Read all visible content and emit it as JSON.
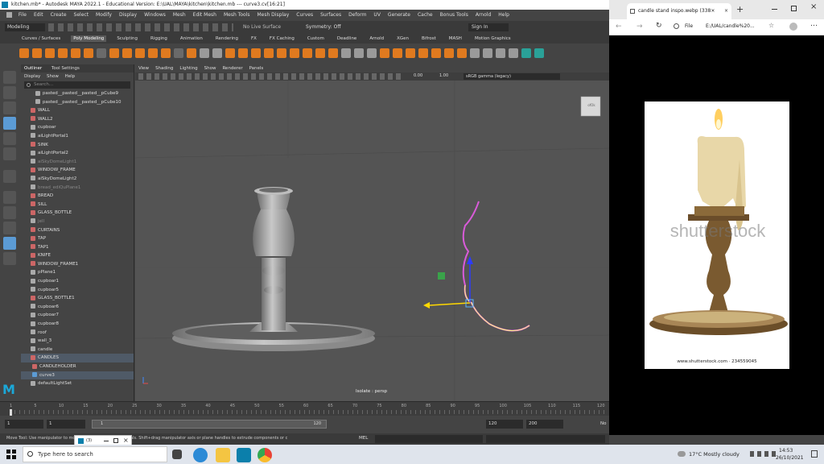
{
  "maya": {
    "title": "kitchen.mb* - Autodesk MAYA 2022.1 - Educational Version: E:\\UAL\\MAYA\\kitchen\\kitchen.mb  ---  curve3.cv[16:21]",
    "menu": [
      "File",
      "Edit",
      "Create",
      "Select",
      "Modify",
      "Display",
      "Windows",
      "Mesh",
      "Edit Mesh",
      "Mesh Tools",
      "Mesh Display",
      "Curves",
      "Surfaces",
      "Deform",
      "UV",
      "Generate",
      "Cache",
      "Bonus Tools",
      "Arnold",
      "Help"
    ],
    "status": {
      "mode": "Modeling",
      "live": "No Live Surface",
      "symmetry": "Symmetry: Off",
      "signin": "Sign In"
    },
    "shelf_tabs": [
      "Curves / Surfaces",
      "Poly Modeling",
      "Sculpting",
      "Rigging",
      "Animation",
      "Rendering",
      "FX",
      "FX Caching",
      "Custom",
      "Deadline",
      "Arnold",
      "XGen",
      "Bifrost",
      "MASH",
      "Motion Graphics"
    ],
    "outliner": {
      "tabs": [
        "Outliner",
        "Tool Settings"
      ],
      "menu": [
        "Display",
        "Show",
        "Help"
      ],
      "search": "Search...",
      "items": [
        "pasted__pasted__pasted__pCube9",
        "pasted__pasted__pasted__pCube10",
        "WALL",
        "WALL2",
        "cupboar",
        "aiLightPortal1",
        "SINK",
        "aiLightPortal2",
        "aiSkyDomeLight1",
        "WINDOW_FRAME",
        "aiSkyDomeLight2",
        "bread_ediQuPlane1",
        "BREAD",
        "SILL",
        "GLASS_BOTTLE",
        "jell",
        "CURTAINS",
        "TAP",
        "TAP1",
        "KNIFE",
        "WINDOW_FRAME1",
        "pPlane1",
        "cupboar1",
        "cupboar5",
        "GLASS_BOTTLE1",
        "cupboar6",
        "cupboar7",
        "cupboar8",
        "roof",
        "wall_3",
        "candle",
        "CANDLES",
        "CANDLEHOLDER",
        "curve3",
        "defaultLightSet"
      ]
    },
    "viewport": {
      "menu": [
        "View",
        "Shading",
        "Lighting",
        "Show",
        "Renderer",
        "Panels"
      ],
      "exposure": "0.00",
      "gamma": "1.00",
      "colorspace": "sRGB gamma (legacy)",
      "label": "Isolate : persp",
      "cube": "ofOk"
    },
    "timeline": {
      "ticks": [
        "1",
        "5",
        "10",
        "15",
        "20",
        "25",
        "30",
        "35",
        "40",
        "45",
        "50",
        "55",
        "60",
        "65",
        "70",
        "75",
        "80",
        "85",
        "90",
        "95",
        "100",
        "105",
        "110",
        "115",
        "120"
      ],
      "start": "1",
      "cur": "1",
      "range_start": "1",
      "range_end": "120",
      "end": "120",
      "end2": "200",
      "no_char": "No"
    },
    "help": "Move Tool: Use manipulator to move components along normals. Shift+drag manipulator axis or plane handles to extrude components or c",
    "mel": "MEL"
  },
  "browser": {
    "tab": "candle stand inspo.webp (338×",
    "file": "File",
    "url": "E:/UAL/candle%20...",
    "watermark": "shutterstock",
    "caption": "www.shutterstock.com · 234559045"
  },
  "taskbar": {
    "search": "Type here to search",
    "weather": "17°C  Mostly cloudy",
    "time": "14:53",
    "date": "26/10/2021",
    "popup_label": "(3)"
  },
  "colors": {
    "accent": "#5b9bd5",
    "maya_bg": "#444444",
    "viewport": "#545454"
  }
}
